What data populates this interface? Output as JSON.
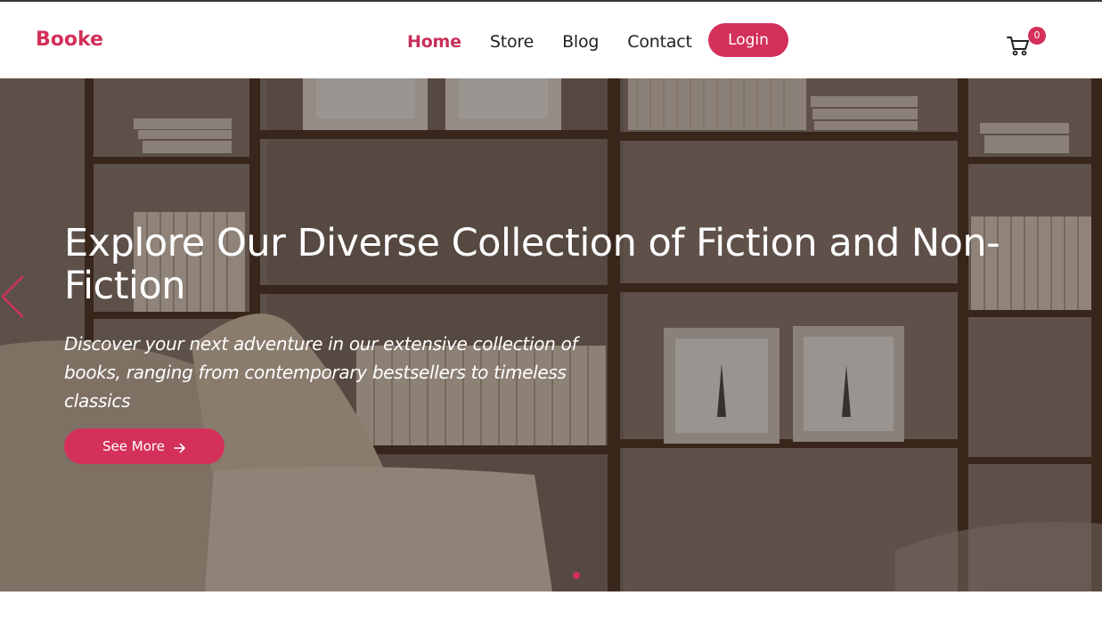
{
  "brand": {
    "name": "Booke",
    "color": "#d3305a"
  },
  "nav": {
    "items": [
      {
        "label": "Home",
        "active": true
      },
      {
        "label": "Store",
        "active": false
      },
      {
        "label": "Blog",
        "active": false
      },
      {
        "label": "Contact",
        "active": false
      }
    ],
    "login_label": "Login"
  },
  "cart": {
    "icon": "cart-icon",
    "count": "0"
  },
  "hero": {
    "title": "Explore Our Diverse Collection of Fiction and Non-Fiction",
    "subtitle": "Discover your next adventure in our extensive collection of books, ranging from contemporary bestsellers to timeless classics",
    "cta_label": "See More",
    "cta_icon": "arrow-right-icon",
    "prev_icon": "chevron-left-icon",
    "background": "bookshelf-living-room-photo"
  },
  "carousel": {
    "active_slide": 1,
    "total_slides": 1
  },
  "colors": {
    "accent": "#d3305a",
    "text": "#222222",
    "hero_text": "#ffffff"
  }
}
